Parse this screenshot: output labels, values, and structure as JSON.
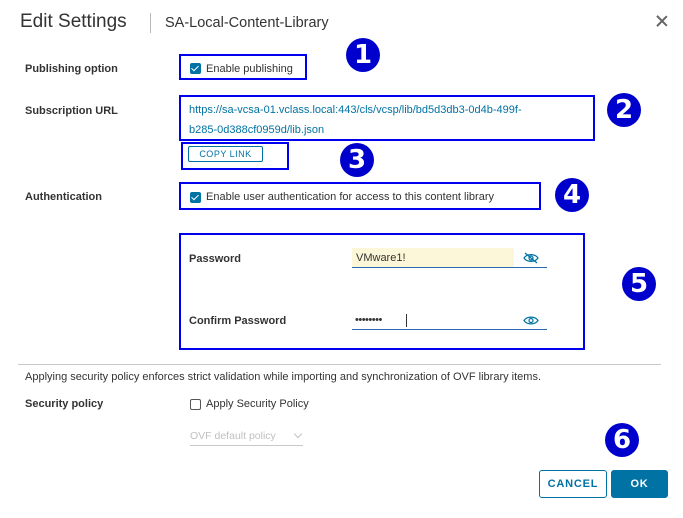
{
  "dialog": {
    "title": "Edit Settings",
    "subtitle": "SA-Local-Content-Library"
  },
  "publishing": {
    "label": "Publishing option",
    "checkbox_label": "Enable publishing",
    "checked": true
  },
  "subscription": {
    "label": "Subscription URL",
    "url_line1": "https://sa-vcsa-01.vclass.local:443/cls/vcsp/lib/bd5d3db3-0d4b-499f-",
    "url_line2": "b285-0d388cf0959d/lib.json",
    "copy_link": "COPY LINK"
  },
  "authentication": {
    "label": "Authentication",
    "checkbox_label": "Enable user authentication for access to this content library",
    "checked": true
  },
  "password": {
    "label": "Password",
    "value": "VMware1!",
    "confirm_label": "Confirm Password",
    "confirm_value": "••••••••"
  },
  "security": {
    "notice": "Applying security policy enforces strict validation while importing and synchronization of OVF library items.",
    "label": "Security policy",
    "checkbox_label": "Apply Security Policy",
    "checked": false,
    "policy_select": "OVF default policy"
  },
  "footer": {
    "cancel": "CANCEL",
    "ok": "OK"
  },
  "annotations": [
    "1",
    "2",
    "3",
    "4",
    "5",
    "6"
  ],
  "colors": {
    "accent": "#0072a3",
    "highlight": "#0000ee",
    "badge": "#0000cc",
    "password_bg": "#fcf7d8"
  }
}
